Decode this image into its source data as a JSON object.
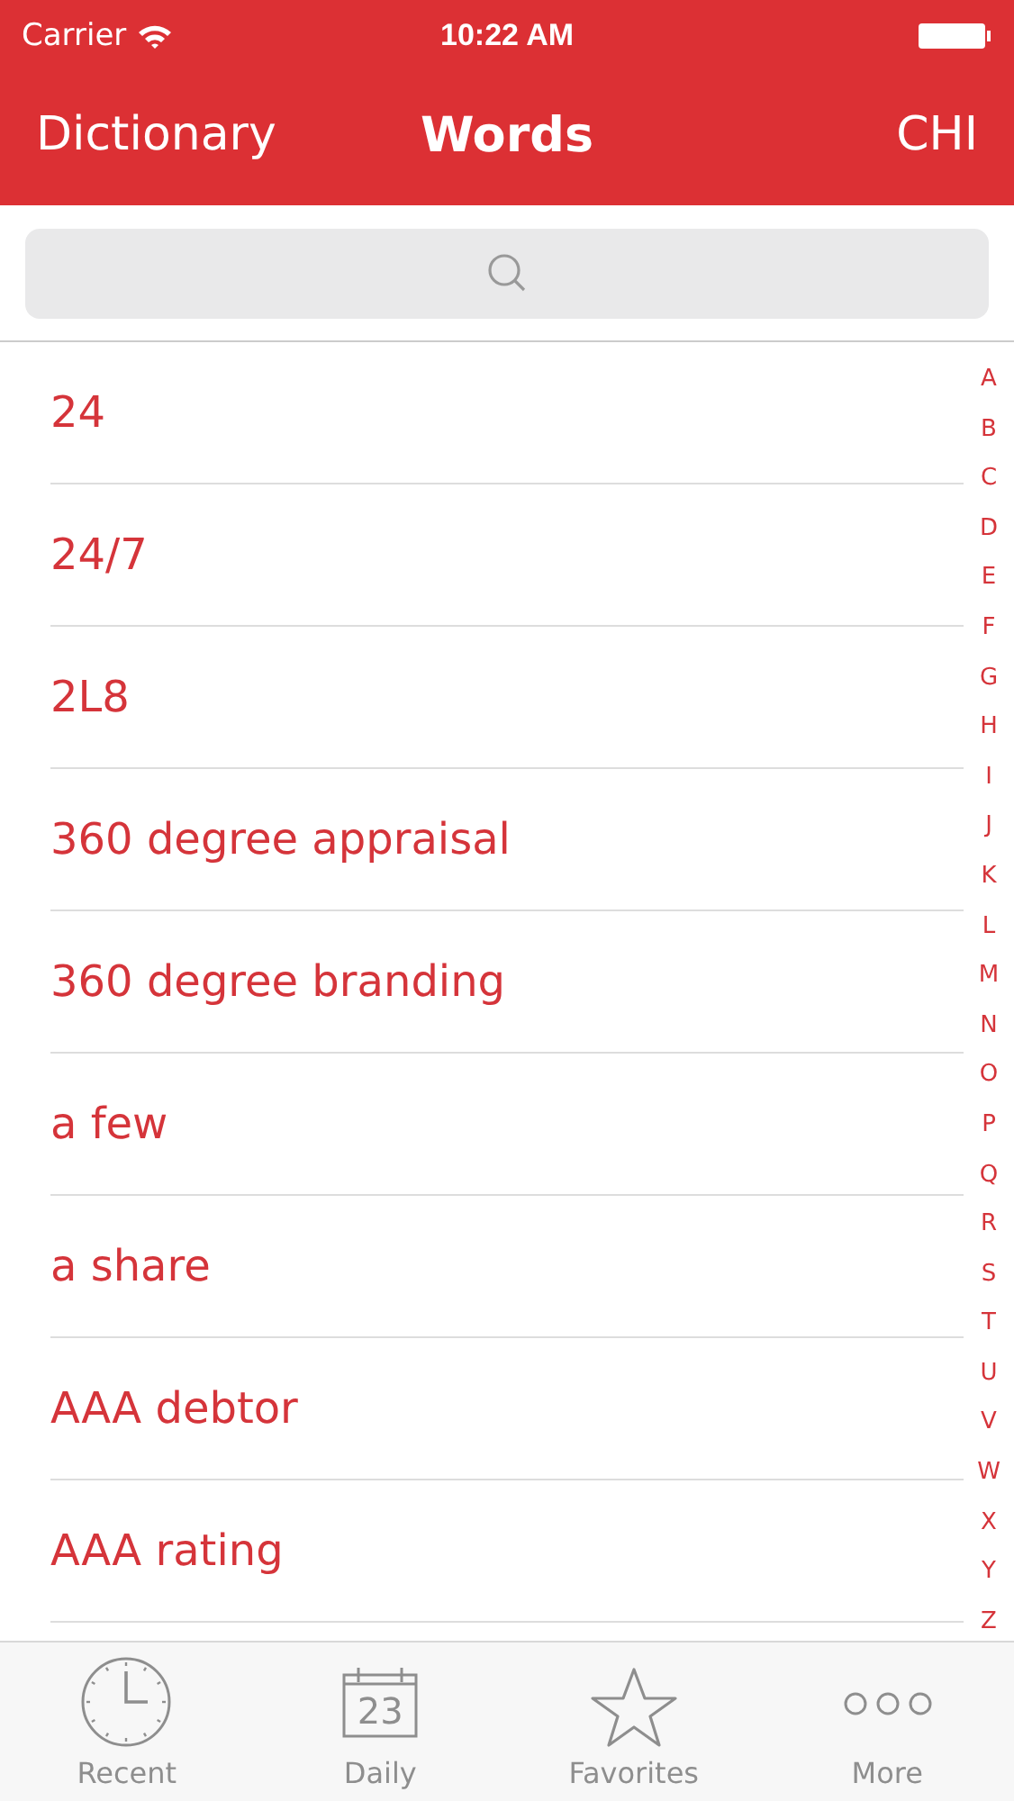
{
  "status_bar": {
    "carrier": "Carrier",
    "time": "10:22 AM"
  },
  "nav": {
    "back": "Dictionary",
    "title": "Words",
    "right": "CHI"
  },
  "words": [
    "24",
    "24/7",
    "2L8",
    "360 degree appraisal",
    "360 degree branding",
    "a few",
    "a share",
    "AAA debtor",
    "AAA rating"
  ],
  "index": [
    "A",
    "B",
    "C",
    "D",
    "E",
    "F",
    "G",
    "H",
    "I",
    "J",
    "K",
    "L",
    "M",
    "N",
    "O",
    "P",
    "Q",
    "R",
    "S",
    "T",
    "U",
    "V",
    "W",
    "X",
    "Y",
    "Z"
  ],
  "tabs": [
    {
      "label": "Recent",
      "kind": "clock",
      "selected": false
    },
    {
      "label": "Daily",
      "kind": "calendar",
      "day": "23",
      "selected": false
    },
    {
      "label": "Favorites",
      "kind": "star",
      "selected": false
    },
    {
      "label": "More",
      "kind": "more",
      "selected": false
    }
  ]
}
